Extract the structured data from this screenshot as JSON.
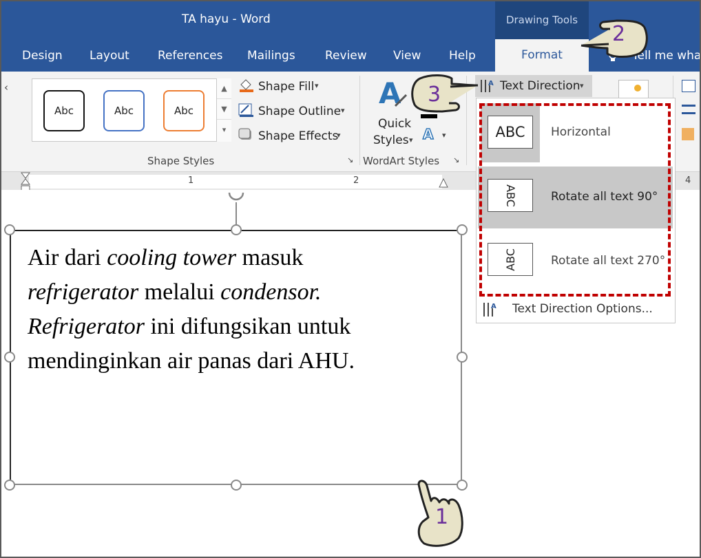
{
  "window": {
    "title": "TA hayu  -  Word",
    "context_tab_group": "Drawing Tools"
  },
  "tabs": [
    "Design",
    "Layout",
    "References",
    "Mailings",
    "Review",
    "View",
    "Help",
    "Format",
    "Tell me wha"
  ],
  "ribbon": {
    "shape_styles": {
      "gallery": [
        "Abc",
        "Abc",
        "Abc"
      ],
      "shape_fill": "Shape Fill",
      "shape_outline": "Shape Outline",
      "shape_effects": "Shape Effects",
      "group_label": "Shape Styles"
    },
    "wordart": {
      "quick": "Quick",
      "styles": "Styles",
      "group_label": "WordArt Styles"
    },
    "text_direction": "Text Direction"
  },
  "ruler": {
    "ticks": [
      "1",
      "2",
      "4"
    ]
  },
  "menu": {
    "items": [
      {
        "icon_text": "ABC",
        "label": "Horizontal"
      },
      {
        "icon_text": "ABC",
        "label": "Rotate all text 90°"
      },
      {
        "icon_text": "ABC",
        "label": "Rotate all text 270°"
      }
    ],
    "options": "Text Direction Options..."
  },
  "textbox": {
    "line1": {
      "a": "Air dari ",
      "b": "cooling tower",
      "c": " masuk"
    },
    "line2": {
      "a": "refrigerator",
      "b": " melalui ",
      "c": "condensor."
    },
    "line3": {
      "a": "Refrigerator",
      "b": " ini difungsikan untuk"
    },
    "line4": "mendinginkan air panas dari AHU."
  },
  "steps": [
    "1",
    "2",
    "3"
  ],
  "colors": {
    "ribbon_blue": "#2b579a",
    "highlight_red": "#c00000",
    "step_purple": "#6a2e9a"
  }
}
